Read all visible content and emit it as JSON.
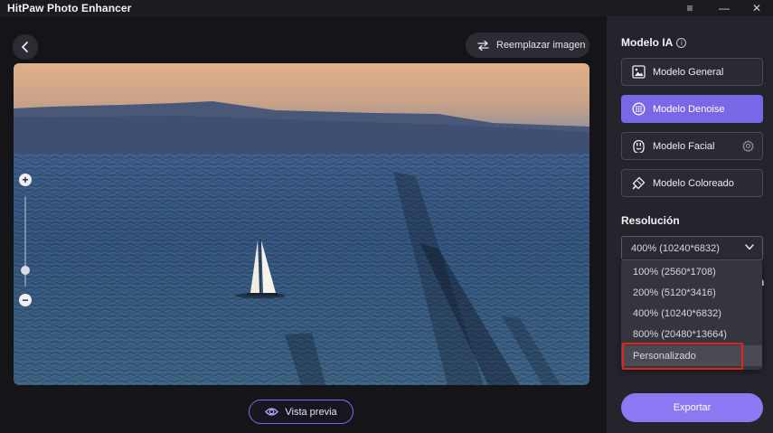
{
  "window": {
    "title": "HitPaw Photo Enhancer",
    "controls": [
      "≡",
      "—",
      "✕"
    ]
  },
  "main": {
    "back_icon": "chevron-left-icon",
    "replace_button": {
      "label": "Reemplazar imagen",
      "icon": "swap-arrows-icon"
    },
    "preview_button": {
      "label": "Vista previa",
      "icon": "eye-icon"
    },
    "zoom": {
      "plus": "+",
      "minus": "−",
      "level": 0.2
    }
  },
  "panel": {
    "model_title": "Modelo IA",
    "info_icon": "i",
    "models": [
      {
        "label": "Modelo General",
        "icon": "image-icon",
        "active": false
      },
      {
        "label": "Modelo Denoise",
        "icon": "denoise-icon",
        "active": true
      },
      {
        "label": "Modelo Facial",
        "icon": "face-icon",
        "active": false,
        "has_settings": true
      },
      {
        "label": "Modelo Coloreado",
        "icon": "colorize-icon",
        "active": false
      }
    ],
    "resolution_title": "Resolución",
    "resolution_selected": "400% (10240*6832)",
    "resolution_options": [
      "100% (2560*1708)",
      "200% (5120*3416)",
      "400% (10240*6832)",
      "800% (20480*13664)",
      "Personalizado"
    ],
    "highlighted_option": "Personalizado",
    "partial_text": "n",
    "export_label": "Exportar"
  },
  "colors": {
    "accent": "#7968e6",
    "export": "#8a79f2",
    "highlight_box": "#e0251c"
  }
}
